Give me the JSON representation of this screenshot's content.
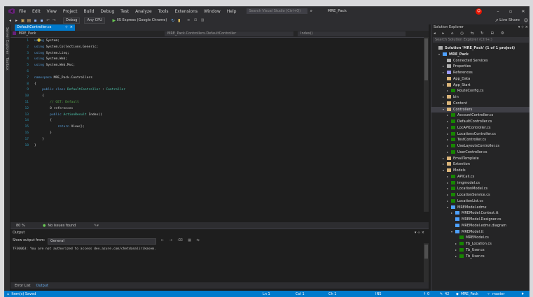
{
  "window": {
    "logo": "visual-studio-logo",
    "menu": [
      "File",
      "Edit",
      "View",
      "Project",
      "Build",
      "Debug",
      "Test",
      "Analyze",
      "Tools",
      "Extensions",
      "Window",
      "Help"
    ],
    "search_placeholder": "Search Visual Studio (Ctrl+Q)",
    "project_name": "MRE_Pack",
    "live_share": "Live Share",
    "accent": "#007acc",
    "notification_color": "#e51400"
  },
  "toolbar": {
    "config": "Debug",
    "platform": "Any CPU",
    "run_target": "IIS Express (Google Chrome)"
  },
  "left_strip": [
    "Server Explorer",
    "Toolbox"
  ],
  "editor": {
    "tab_label": "DefaultController.cs",
    "nav_project": "MRE_Pack",
    "nav_class": "MRE_Pack.Controllers.DefaultController",
    "nav_member": "Index()",
    "lines": [
      {
        "n": "1",
        "parts": [
          {
            "c": "kw",
            "t": "using "
          },
          {
            "c": "tx",
            "t": "System;"
          }
        ]
      },
      {
        "n": "2",
        "parts": [
          {
            "c": "kw",
            "t": "using "
          },
          {
            "c": "tx",
            "t": "System.Collections.Generic;"
          }
        ]
      },
      {
        "n": "3",
        "parts": [
          {
            "c": "kw",
            "t": "using "
          },
          {
            "c": "tx",
            "t": "System.Linq;"
          }
        ]
      },
      {
        "n": "4",
        "parts": [
          {
            "c": "kw",
            "t": "using "
          },
          {
            "c": "tx",
            "t": "System.Web;"
          }
        ]
      },
      {
        "n": "5",
        "parts": [
          {
            "c": "kw",
            "t": "using "
          },
          {
            "c": "tx",
            "t": "System.Web.Mvc;"
          }
        ]
      },
      {
        "n": "6",
        "parts": []
      },
      {
        "n": "7",
        "parts": [
          {
            "c": "kw",
            "t": "namespace "
          },
          {
            "c": "tx",
            "t": "MRE_Pack.Controllers"
          }
        ]
      },
      {
        "n": "8",
        "parts": [
          {
            "c": "tx",
            "t": "{"
          }
        ]
      },
      {
        "n": "9",
        "parts": [
          {
            "c": "kw",
            "t": "    public class "
          },
          {
            "c": "ty",
            "t": "DefaultController"
          },
          {
            "c": "tx",
            "t": " : "
          },
          {
            "c": "ty",
            "t": "Controller"
          }
        ]
      },
      {
        "n": "10",
        "parts": [
          {
            "c": "tx",
            "t": "    {"
          }
        ]
      },
      {
        "n": "11",
        "parts": [
          {
            "c": "cm",
            "t": "        // GET: Default"
          }
        ]
      },
      {
        "n": "12",
        "parts": [
          {
            "c": "na",
            "t": "        0 references"
          }
        ]
      },
      {
        "n": "13",
        "parts": [
          {
            "c": "kw",
            "t": "        public "
          },
          {
            "c": "ty",
            "t": "ActionResult"
          },
          {
            "c": "tx",
            "t": " Index()"
          }
        ]
      },
      {
        "n": "14",
        "parts": [
          {
            "c": "tx",
            "t": "        {"
          }
        ]
      },
      {
        "n": "15",
        "parts": [
          {
            "c": "kw",
            "t": "            return "
          },
          {
            "c": "tx",
            "t": "View();"
          }
        ]
      },
      {
        "n": "16",
        "parts": [
          {
            "c": "tx",
            "t": "        }"
          }
        ]
      },
      {
        "n": "17",
        "parts": [
          {
            "c": "tx",
            "t": "    }"
          }
        ]
      },
      {
        "n": "18",
        "parts": [
          {
            "c": "tx",
            "t": "}"
          }
        ]
      }
    ],
    "zoom": "80 %",
    "issues": "No issues found"
  },
  "output": {
    "title": "Output",
    "show_from_label": "Show output from:",
    "show_from_value": "General",
    "message": "TF30063: You are not authorized to access dev.azure.com/chetdanalirikasem."
  },
  "bottom_tabs": [
    "Error List",
    "Output"
  ],
  "statusbar": {
    "left": "Item(s) Saved",
    "ln": "Ln 1",
    "col": "Col 1",
    "ch": "Ch 1",
    "ins": "INS",
    "up": "0",
    "pencil": "42",
    "repo": "MRE_Pack",
    "branch": "master"
  },
  "solution_explorer": {
    "title": "Solution Explorer",
    "search_placeholder": "Search Solution Explorer (Ctrl+;)",
    "items": [
      {
        "d": 0,
        "arrow": "",
        "icon": "solution",
        "label": "Solution 'MRE_Pack' (1 of 1 project)"
      },
      {
        "d": 1,
        "arrow": "▾",
        "icon": "project",
        "label": "MRE_Pack"
      },
      {
        "d": 2,
        "arrow": "",
        "icon": "wrench",
        "label": "Connected Services"
      },
      {
        "d": 2,
        "arrow": "▸",
        "icon": "wrench",
        "label": "Properties"
      },
      {
        "d": 2,
        "arrow": "▸",
        "icon": "refs",
        "label": "References"
      },
      {
        "d": 2,
        "arrow": "",
        "icon": "folder",
        "label": "App_Data"
      },
      {
        "d": 2,
        "arrow": "▾",
        "icon": "folder",
        "label": "App_Start"
      },
      {
        "d": 3,
        "arrow": "▸",
        "icon": "cs",
        "label": "RouteConfig.cs"
      },
      {
        "d": 2,
        "arrow": "▸",
        "icon": "folder",
        "label": "bin"
      },
      {
        "d": 2,
        "arrow": "▸",
        "icon": "folder",
        "label": "Content"
      },
      {
        "d": 2,
        "arrow": "▾",
        "icon": "folder",
        "label": "Controllers"
      },
      {
        "d": 3,
        "arrow": "▸",
        "icon": "cs",
        "label": "AccountController.cs"
      },
      {
        "d": 3,
        "arrow": "▸",
        "icon": "cs",
        "label": "DefaultController.cs"
      },
      {
        "d": 3,
        "arrow": "▸",
        "icon": "cs",
        "label": "LocAPIController.cs"
      },
      {
        "d": 3,
        "arrow": "▸",
        "icon": "cs",
        "label": "LocationsController.cs"
      },
      {
        "d": 3,
        "arrow": "▸",
        "icon": "cs",
        "label": "TestController.cs"
      },
      {
        "d": 3,
        "arrow": "▸",
        "icon": "cs",
        "label": "UseLayoutsController.cs"
      },
      {
        "d": 3,
        "arrow": "▸",
        "icon": "cs",
        "label": "UserController.cs"
      },
      {
        "d": 2,
        "arrow": "▸",
        "icon": "folder",
        "label": "EmailTemplate"
      },
      {
        "d": 2,
        "arrow": "▸",
        "icon": "folder",
        "label": "Extention"
      },
      {
        "d": 2,
        "arrow": "▾",
        "icon": "folder",
        "label": "Models"
      },
      {
        "d": 3,
        "arrow": "▸",
        "icon": "cs",
        "label": "APICall.cs"
      },
      {
        "d": 3,
        "arrow": "▸",
        "icon": "cs",
        "label": "imgmodel.cs"
      },
      {
        "d": 3,
        "arrow": "▸",
        "icon": "cs",
        "label": "LocationModel.cs"
      },
      {
        "d": 3,
        "arrow": "▸",
        "icon": "cs",
        "label": "LocationService.cs"
      },
      {
        "d": 3,
        "arrow": "▸",
        "icon": "cs",
        "label": "LocationList.cs"
      },
      {
        "d": 3,
        "arrow": "▾",
        "icon": "edmx",
        "label": "MREModel.edmx"
      },
      {
        "d": 4,
        "arrow": "▸",
        "icon": "edmx",
        "label": "MREModel.Context.tt"
      },
      {
        "d": 4,
        "arrow": "",
        "icon": "edmx",
        "label": "MREModel.Designer.cs"
      },
      {
        "d": 4,
        "arrow": "",
        "icon": "edmx",
        "label": "MREModel.edmx.diagram"
      },
      {
        "d": 4,
        "arrow": "▾",
        "icon": "edmx",
        "label": "MREModel.tt"
      },
      {
        "d": 5,
        "arrow": "",
        "icon": "cs",
        "label": "MREModel.cs"
      },
      {
        "d": 5,
        "arrow": "▸",
        "icon": "cs",
        "label": "Tb_Location.cs"
      },
      {
        "d": 5,
        "arrow": "▸",
        "icon": "cs",
        "label": "Tb_User.cs"
      },
      {
        "d": 5,
        "arrow": "▸",
        "icon": "cs",
        "label": "Tb_User.cs"
      }
    ]
  }
}
